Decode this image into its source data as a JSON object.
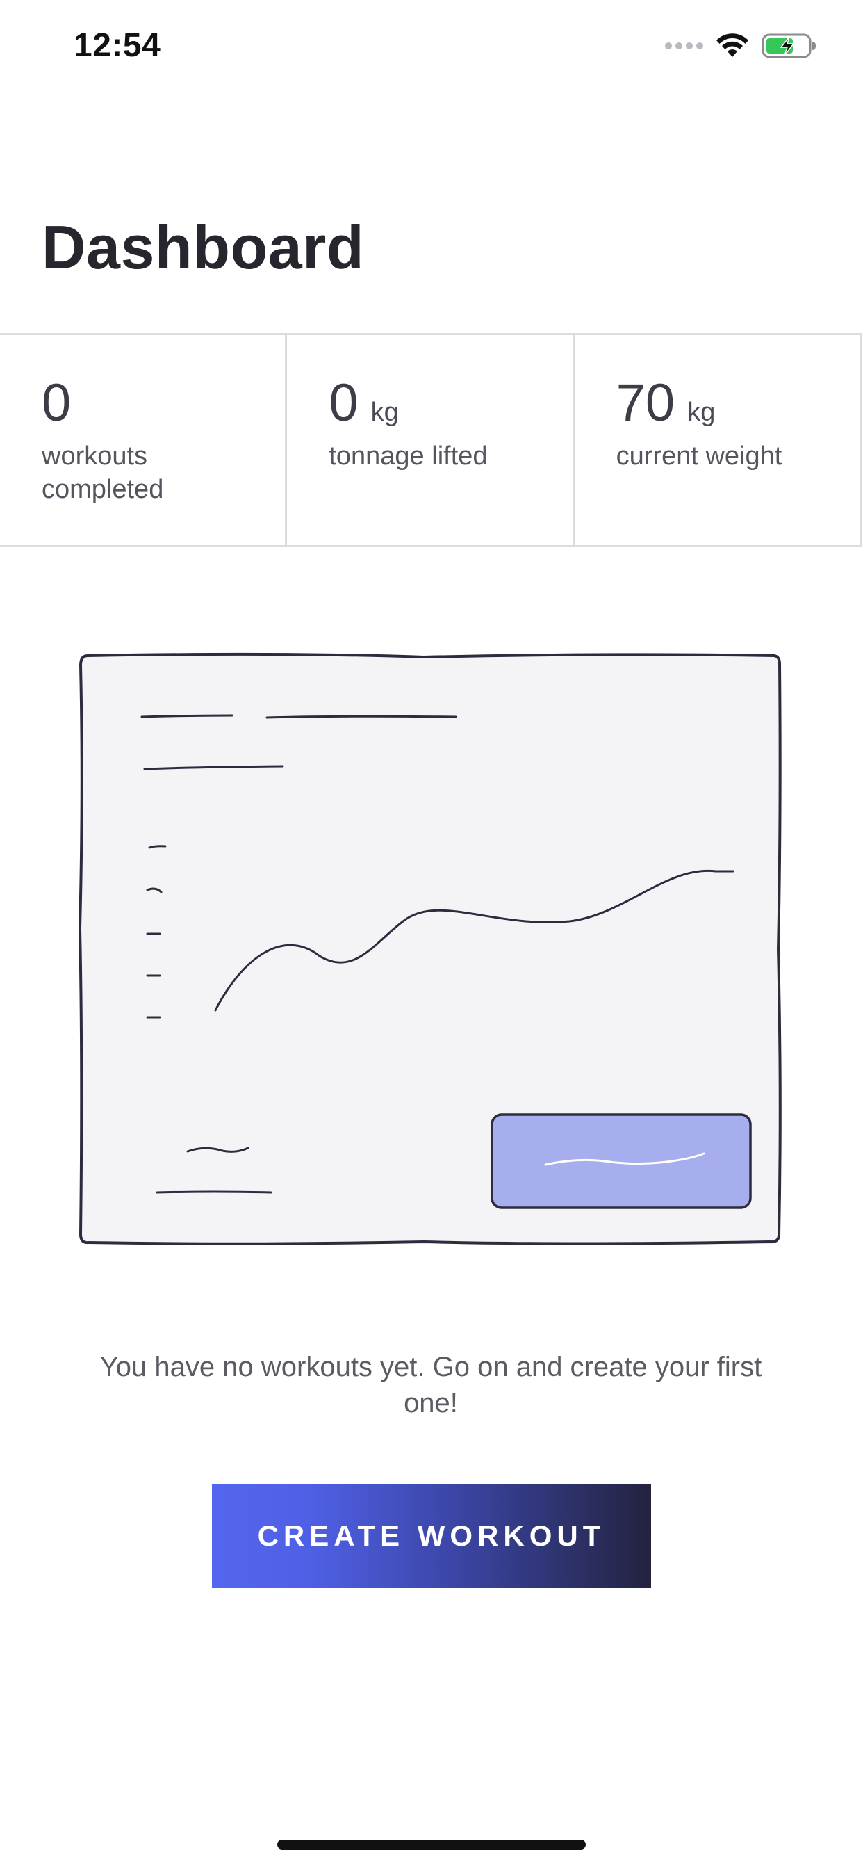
{
  "status_bar": {
    "time": "12:54",
    "icons": [
      "signal-icon",
      "wifi-icon",
      "battery-charging-icon"
    ]
  },
  "header": {
    "title": "Dashboard"
  },
  "stats": [
    {
      "value": "0",
      "unit": "",
      "label": "workouts completed"
    },
    {
      "value": "0",
      "unit": "kg",
      "label": "tonnage lifted"
    },
    {
      "value": "70",
      "unit": "kg",
      "label": "current weight"
    }
  ],
  "empty_state": {
    "message": "You have no workouts yet. Go on and create your first one!",
    "button_label": "CREATE WORKOUT"
  },
  "colors": {
    "accent": "#5566ee",
    "accent_dark": "#23233f",
    "illustration_fill": "#f4f4f7",
    "illustration_highlight": "#a6aeee",
    "stroke": "#2c2c3f"
  }
}
